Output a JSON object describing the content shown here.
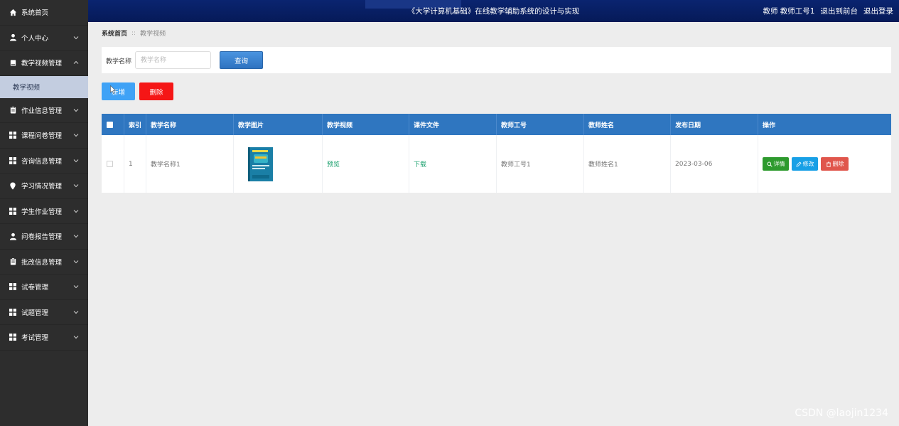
{
  "header": {
    "title": "《大学计算机基础》在线教学辅助系统的设计与实现",
    "user": "教师 教师工号1",
    "to_front": "退出到前台",
    "logout": "退出登录"
  },
  "sidebar": {
    "items": [
      {
        "label": "系统首页",
        "icon": "home-icon"
      },
      {
        "label": "个人中心",
        "icon": "user-icon"
      },
      {
        "label": "教学视频管理",
        "icon": "book-icon"
      },
      {
        "label": "作业信息管理",
        "icon": "clipboard-icon"
      },
      {
        "label": "课程问卷管理",
        "icon": "grid-icon"
      },
      {
        "label": "咨询信息管理",
        "icon": "grid-icon"
      },
      {
        "label": "学习情况管理",
        "icon": "location-pin-icon"
      },
      {
        "label": "学生作业管理",
        "icon": "grid-icon"
      },
      {
        "label": "问卷报告管理",
        "icon": "user-icon"
      },
      {
        "label": "批改信息管理",
        "icon": "clipboard-icon"
      },
      {
        "label": "试卷管理",
        "icon": "grid-icon"
      },
      {
        "label": "试题管理",
        "icon": "grid-icon"
      },
      {
        "label": "考试管理",
        "icon": "grid-icon"
      }
    ],
    "sub_item": "教学视频"
  },
  "breadcrumb": {
    "home": "系统首页",
    "separator": "::",
    "current": "教学视频"
  },
  "search": {
    "label": "教学名称",
    "placeholder": "教学名称",
    "value": "",
    "button": "查询"
  },
  "actions": {
    "add": "新增",
    "delete": "删除"
  },
  "table": {
    "columns": [
      "索引",
      "教学名称",
      "教学图片",
      "教学视频",
      "课件文件",
      "教师工号",
      "教师姓名",
      "发布日期",
      "操作"
    ],
    "rows": [
      {
        "index": "1",
        "name": "教学名称1",
        "video": "预览",
        "file": "下载",
        "teacher_no": "教师工号1",
        "teacher_name": "教师姓名1",
        "date": "2023-03-06"
      }
    ],
    "row_actions": {
      "detail": "详情",
      "edit": "修改",
      "delete": "删除"
    }
  },
  "watermark": "CSDN @laojin1234",
  "colors": {
    "header": "#0a2470",
    "sidebar": "#2d2d2d",
    "table_header": "#2f76c0",
    "add_button": "#3fa2f6",
    "delete_button": "#f51616",
    "detail_button": "#2e9a2e",
    "edit_button": "#18a0e6",
    "row_delete_button": "#e0564c",
    "link": "#1aa06d"
  }
}
